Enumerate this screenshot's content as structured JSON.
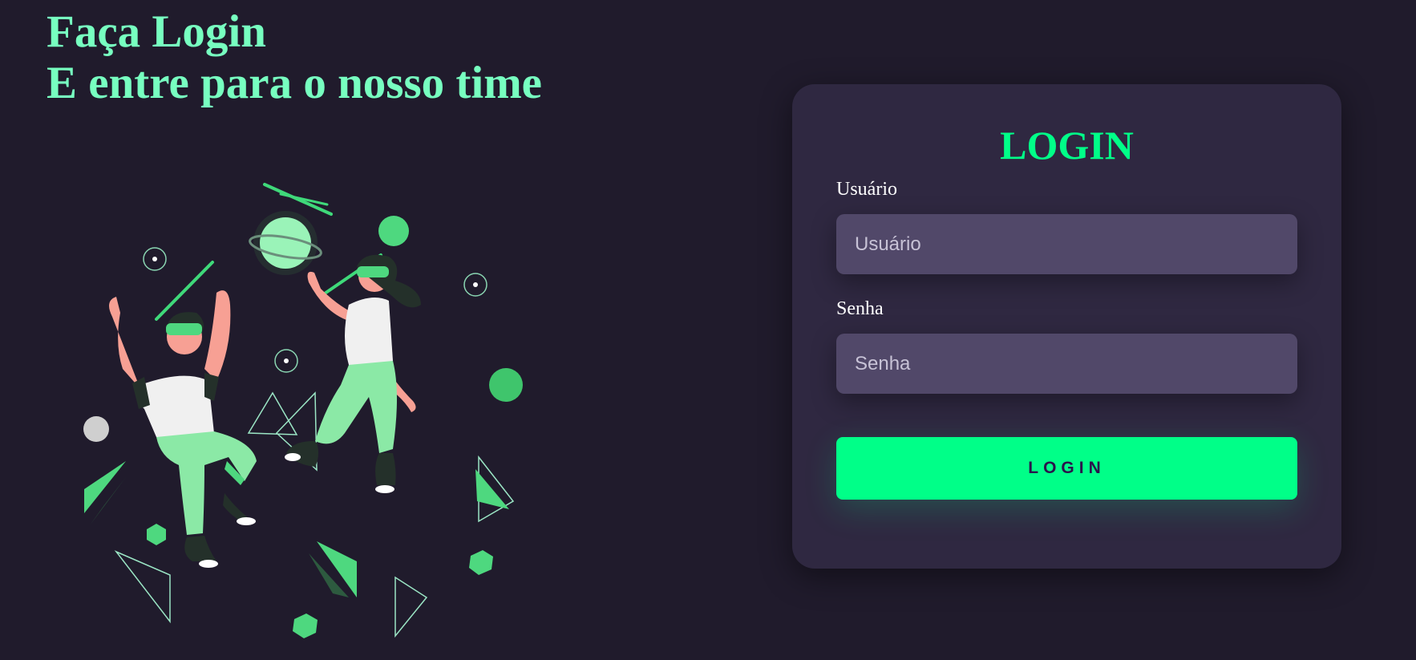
{
  "headline": {
    "line1": "Faça Login",
    "line2": "E entre para o nosso time"
  },
  "login_card": {
    "title": "LOGIN",
    "username_label": "Usuário",
    "username_placeholder": "Usuário",
    "password_label": "Senha",
    "password_placeholder": "Senha",
    "submit_label": "LOGIN"
  },
  "colors": {
    "background": "#201b2c",
    "card": "#2f2841",
    "accent": "#00ff88",
    "headline": "#77ffc0",
    "input": "#514869"
  },
  "illustration": {
    "icon": "vr-people-illustration"
  }
}
